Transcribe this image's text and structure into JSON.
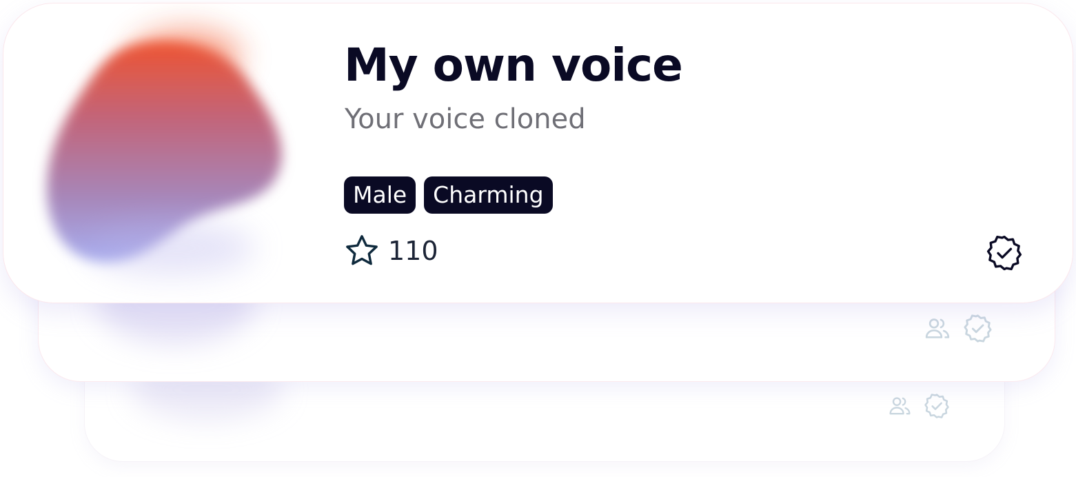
{
  "voice_card": {
    "title": "My own voice",
    "subtitle": "Your voice cloned",
    "tags": [
      "Male",
      "Charming"
    ],
    "rating_count": "110",
    "icons": {
      "rating": "star-icon",
      "status": "verified-badge-icon"
    }
  },
  "stacked_cards": [
    {
      "icons": [
        "users-icon",
        "verified-badge-icon"
      ]
    },
    {
      "icons": [
        "users-icon",
        "verified-badge-icon"
      ]
    }
  ],
  "colors": {
    "text_primary": "#0a0a24",
    "text_secondary": "#6f6f76",
    "tag_background": "#0a0a24",
    "tag_text": "#ffffff",
    "icon_dark": "#0a0a24",
    "icon_faint": "#c9d6df",
    "blob_top": "#ee5431",
    "blob_bottom": "#a7aef0"
  }
}
